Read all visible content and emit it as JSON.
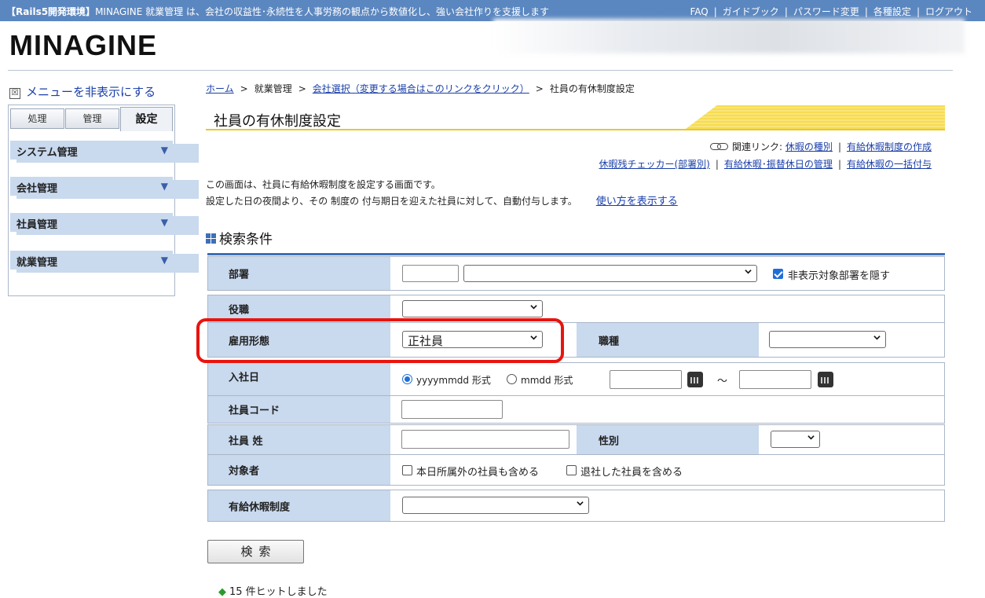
{
  "header": {
    "env_badge": "【Rails5開発環境】",
    "tagline": "MINAGINE 就業管理 は、会社の収益性･永続性を人事労務の観点から数値化し、強い会社作りを支援します",
    "links": [
      "FAQ",
      "ガイドブック",
      "パスワード変更",
      "各種設定",
      "ログアウト"
    ],
    "logo": "MINAGINE"
  },
  "sidebar": {
    "hide_menu": "メニューを非表示にする",
    "hide_menu_box": "☒",
    "tabs": [
      "処理",
      "管理",
      "設定"
    ],
    "active_tab": "設定",
    "sections": [
      "システム管理",
      "会社管理",
      "社員管理",
      "就業管理"
    ],
    "arrow": "▼"
  },
  "breadcrumb": {
    "items": [
      "ホーム",
      "就業管理",
      "会社選択（変更する場合はこのリンクをクリック）",
      "社員の有休制度設定"
    ],
    "separator": ">"
  },
  "page": {
    "title": "社員の有休制度設定",
    "related_label": "関連リンク:",
    "related_links_1": [
      "休暇の種別",
      "有給休暇制度の作成"
    ],
    "related_links_2": [
      "休暇残チェッカー(部署別)",
      "有給休暇･振替休日の管理",
      "有給休暇の一括付与"
    ],
    "separator": "|",
    "desc_1": "この画面は、社員に有給休暇制度を設定する画面です。",
    "desc_2": "設定した日の夜間より、その 制度の 付与期日を迎えた社員に対して、自動付与します。",
    "howto_link": "使い方を表示する"
  },
  "search": {
    "heading": "検索条件",
    "dept_label": "部署",
    "dept_hide_label": "非表示対象部署を隠す",
    "position_label": "役職",
    "employment_label": "雇用形態",
    "employment_value": "正社員",
    "job_type_label": "職種",
    "hire_date_label": "入社日",
    "format_1": "yyyymmdd 形式",
    "format_2": "mmdd 形式",
    "tilde": "～",
    "emp_code_label": "社員コード",
    "last_name_label": "社員 姓",
    "gender_label": "性別",
    "target_label": "対象者",
    "target_opt_1": "本日所属外の社員も含める",
    "target_opt_2": "退社した社員を含める",
    "leave_system_label": "有給休暇制度",
    "button": "検索"
  },
  "result": {
    "text": "15 件ヒットしました"
  }
}
